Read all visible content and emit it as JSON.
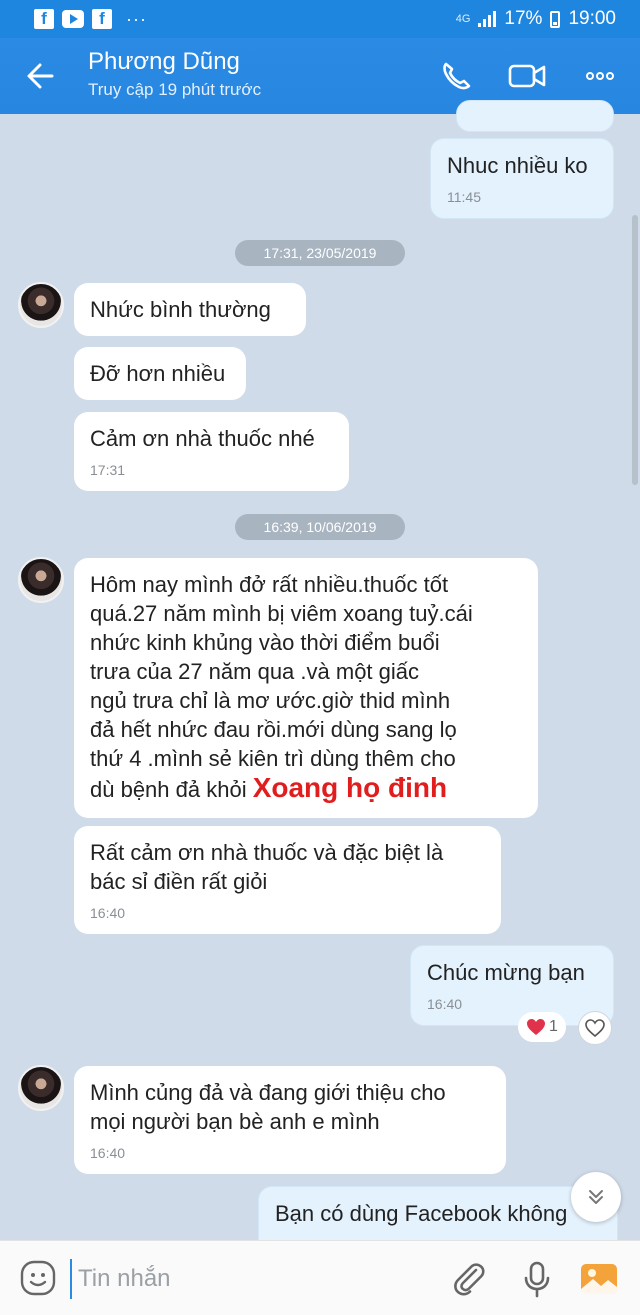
{
  "status_bar": {
    "network": "4G",
    "battery": "17%",
    "time": "19:00",
    "more": "···"
  },
  "header": {
    "name": "Phương Dũng",
    "subtitle": "Truy cập 19 phút trước"
  },
  "messages": [
    {
      "dir": "out",
      "text": "Nhuc nhiều ko",
      "time": "11:45"
    },
    {
      "date": "17:31, 23/05/2019"
    },
    {
      "dir": "in",
      "text": "Nhức bình thường"
    },
    {
      "dir": "in",
      "text": "Đỡ hơn nhiều"
    },
    {
      "dir": "in",
      "text": "Cảm ơn nhà thuốc nhé",
      "time": "17:31"
    },
    {
      "date": "16:39, 10/06/2019"
    },
    {
      "dir": "in",
      "lines": [
        "Hôm nay mình đở rất nhiều.thuốc tốt",
        "quá.27 năm mình bị viêm xoang tuỷ.cái",
        "nhức kinh khủng vào thời điểm buổi",
        "trưa của 27 năm qua .và một giấc",
        "ngủ trưa chỉ là mơ ước.giờ thid mình",
        "đả hết nhức đau rồi.mới dùng sang lọ",
        "thứ 4 .mình sẻ kiên trì dùng thêm cho",
        "dù bệnh đả khỏi"
      ],
      "overlay": "Xoang họ đinh"
    },
    {
      "dir": "in",
      "lines": [
        "Rất cảm ơn nhà thuốc và đặc biệt là",
        "bác sỉ điền rất giỏi"
      ],
      "time": "16:40"
    },
    {
      "dir": "out",
      "text": "Chúc mừng bạn",
      "time": "16:40",
      "reaction_count": "1"
    },
    {
      "dir": "in",
      "lines": [
        "Mình củng đả và đang giới thiệu cho",
        "mọi người bạn bè anh e mình"
      ],
      "time": "16:40"
    },
    {
      "dir": "out",
      "text": "Bạn có dùng Facebook không"
    }
  ],
  "composer": {
    "placeholder": "Tin nhắn"
  },
  "colors": {
    "header": "#2787e0",
    "chat_bg": "#cfdbe9",
    "overlay_text": "#e01e1e"
  }
}
